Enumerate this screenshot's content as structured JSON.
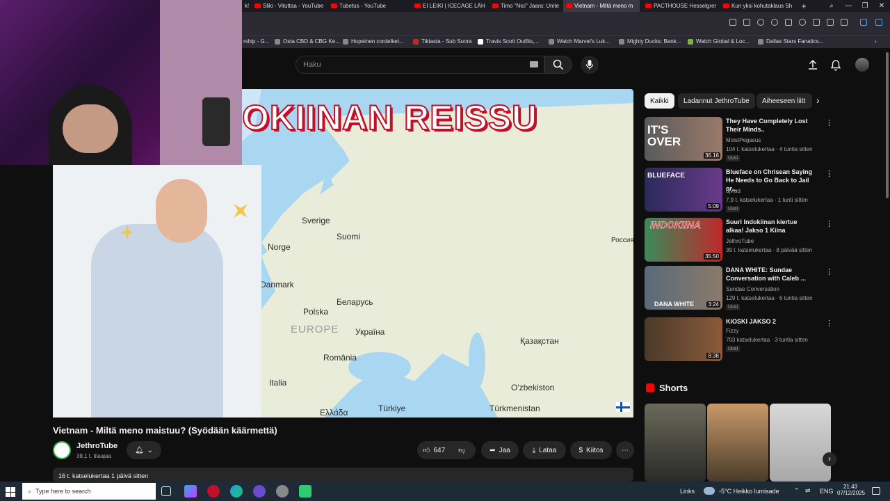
{
  "browser": {
    "tabs": [
      {
        "label": "k!",
        "active": false
      },
      {
        "label": "Sliki - Vituttaa - YouTube",
        "active": false
      },
      {
        "label": "Tubetus - YouTube",
        "active": false
      },
      {
        "label": "EI LEIKI | ICECAGE LÄHEN",
        "active": false
      },
      {
        "label": "Timo \"Nici\" Jaara: Unite",
        "active": false
      },
      {
        "label": "Vietnam - Miltä meno m",
        "active": true
      },
      {
        "label": "PACTHOUSE Hesselgren",
        "active": false
      },
      {
        "label": "Kun yksi kohutaklaus Sh",
        "active": false
      }
    ],
    "new_tab": "+",
    "bookmarks": [
      "rship - G...",
      "Osta CBD & CBG Ke...",
      "Hopeinen cordelket...",
      "Tiktasta - Sub Suora",
      "Travis Scott Outfits,...",
      "Watch Marvel's Luk...",
      "Mighty Ducks: Bank...",
      "Watch Global & Loc...",
      "Dallas Stars Fanatics..."
    ]
  },
  "youtube": {
    "search_placeholder": "Haku",
    "video": {
      "banner_text": "OKIINAN REISSU",
      "map_labels": [
        "Sverige",
        "Suomi",
        "Norge",
        "Danmark",
        "Polska",
        "Беларусь",
        "EUROPE",
        "Україна",
        "România",
        "Italia",
        "Ελλάδα",
        "Türkiye",
        "Türkmenistan",
        "O'zbekiston",
        "Қазақстан",
        "Россия"
      ],
      "title": "Vietnam - Miltä meno maistuu? (Syödään käärmettä)"
    },
    "channel": {
      "name": "JethroTube",
      "subs": "38,1 t. tilaajaa"
    },
    "actions": {
      "likes": "647",
      "share": "Jaa",
      "download": "Lataa",
      "thanks": "Kiitos",
      "more": "⋯"
    },
    "description": {
      "meta": "16 t. katselukertaa  1 päivä sitten"
    },
    "chips": [
      "Kaikki",
      "Ladannut JethroTube",
      "Aiheeseen liitt"
    ],
    "recommendations": [
      {
        "title": "They Have Completely Lost Their Minds..",
        "channel": "MoistPegasus",
        "meta": "104 t. katselukertaa · 4 tuntia sitten",
        "badge": "Uusi",
        "duration": "36.16",
        "thumb_text": "IT'S OVER"
      },
      {
        "title": "Blueface on Chrisean Saying He Needs to Go Back to Jail or...",
        "channel": "djvlad",
        "meta": "7,9 t. katselukertaa · 1 tunti sitten",
        "badge": "Uusi",
        "duration": "5:09",
        "thumb_text": "BLUEFACE"
      },
      {
        "title": "Suuri Indokiinan kiertue alkaa! Jakso 1 Kiina",
        "channel": "JethroTube",
        "meta": "39 t. katselukertaa · 8 päivää sitten",
        "badge": "",
        "duration": "35:50",
        "thumb_text": "INDOKIINA"
      },
      {
        "title": "DANA WHITE: Sundae Conversation with Caleb ...",
        "channel": "Sundae Conversation",
        "meta": "129 t. katselukertaa · 6 tuntia sitten",
        "badge": "Uusi",
        "duration": "3:24",
        "thumb_text": "DANA WHITE"
      },
      {
        "title": "KIOSKI JAKSO 2",
        "channel": "Fizzy",
        "meta": "703 katselukertaa · 3 tuntia sitten",
        "badge": "Uusi",
        "duration": "8:38",
        "thumb_text": ""
      }
    ],
    "shorts_label": "Shorts"
  },
  "taskbar": {
    "search_placeholder": "Type here to search",
    "links": "Links",
    "weather": "-5°C  Heikko lumisade",
    "lang": "ENG",
    "time": "21.43",
    "date": "07/12/2025"
  },
  "colors": {
    "yt_red": "#ff0000",
    "bg": "#0f0f0f",
    "map_water": "#a9d6f0",
    "map_land": "#e9ecd9"
  }
}
